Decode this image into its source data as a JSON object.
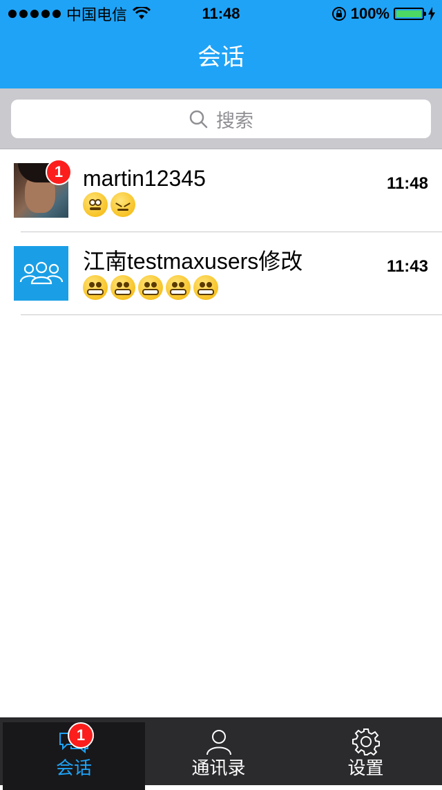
{
  "status_bar": {
    "carrier": "中国电信",
    "time": "11:48",
    "battery": "100%"
  },
  "nav": {
    "title": "会话"
  },
  "search": {
    "placeholder": "搜索"
  },
  "conversations": [
    {
      "name": "martin12345",
      "time": "11:48",
      "unread": "1",
      "preview_emojis": [
        "flushed-face",
        "confounded-face"
      ]
    },
    {
      "name": "江南testmaxusers修改",
      "time": "11:43",
      "preview_emojis": [
        "grimacing-face",
        "grimacing-face",
        "grimacing-face",
        "grimacing-face",
        "grimacing-face"
      ]
    }
  ],
  "tabs": [
    {
      "label": "会话",
      "icon": "chat-bubbles-icon",
      "badge": "1",
      "active": true
    },
    {
      "label": "通讯录",
      "icon": "person-icon"
    },
    {
      "label": "设置",
      "icon": "gear-icon"
    }
  ],
  "colors": {
    "brand": "#1fa3f7",
    "badge": "#fc1e1c",
    "tab_bar": "#2b2b2e"
  }
}
